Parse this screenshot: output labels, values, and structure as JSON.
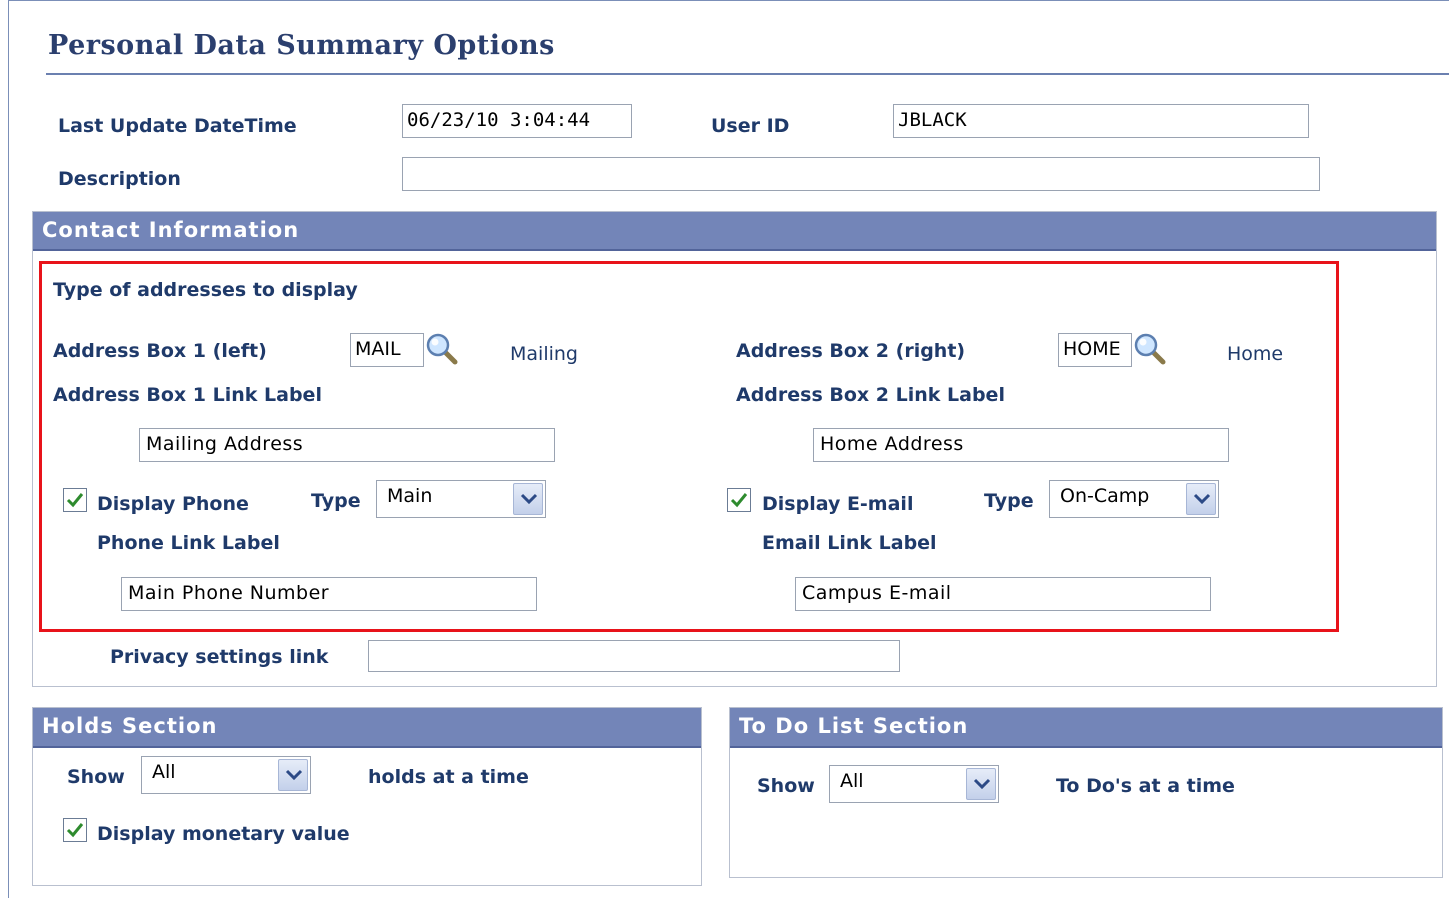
{
  "page_title": "Personal Data Summary Options",
  "header": {
    "last_update_label": "Last Update DateTime",
    "last_update_value": "06/23/10  3:04:44",
    "user_id_label": "User ID",
    "user_id_value": "JBLACK",
    "description_label": "Description",
    "description_value": ""
  },
  "contact": {
    "section_title": "Contact Information",
    "addresses_heading": "Type of addresses to display",
    "box1_label": "Address Box 1 (left)",
    "box1_code": "MAIL",
    "box1_desc": "Mailing",
    "box1_link_label": "Address Box 1 Link Label",
    "box1_link_value": "Mailing Address",
    "box2_label": "Address Box 2 (right)",
    "box2_code": "HOME",
    "box2_desc": "Home",
    "box2_link_label": "Address Box 2 Link Label",
    "box2_link_value": "Home Address",
    "display_phone_label": "Display Phone",
    "display_phone_checked": true,
    "phone_type_label": "Type",
    "phone_type_value": "Main",
    "phone_link_label": "Phone Link Label",
    "phone_link_value": "Main Phone Number",
    "display_email_label": "Display E-mail",
    "display_email_checked": true,
    "email_type_label": "Type",
    "email_type_value": "On-Camp",
    "email_link_label": "Email Link Label",
    "email_link_value": "Campus E-mail",
    "privacy_label": "Privacy settings link",
    "privacy_value": ""
  },
  "holds": {
    "section_title": "Holds Section",
    "show_label": "Show",
    "show_value": "All",
    "suffix": "holds at a time",
    "monetary_label": "Display monetary value",
    "monetary_checked": true
  },
  "todo": {
    "section_title": "To Do List Section",
    "show_label": "Show",
    "show_value": "All",
    "suffix": "To Do's at a time"
  },
  "colors": {
    "title": "#2b3f6e",
    "label": "#1f3a6a",
    "section_header": "#7385b8",
    "highlight_border": "#e8131a",
    "checkmark": "#2e8b2e"
  },
  "icons": [
    "magnifier-icon",
    "checkmark-icon",
    "dropdown-arrow-icon"
  ]
}
